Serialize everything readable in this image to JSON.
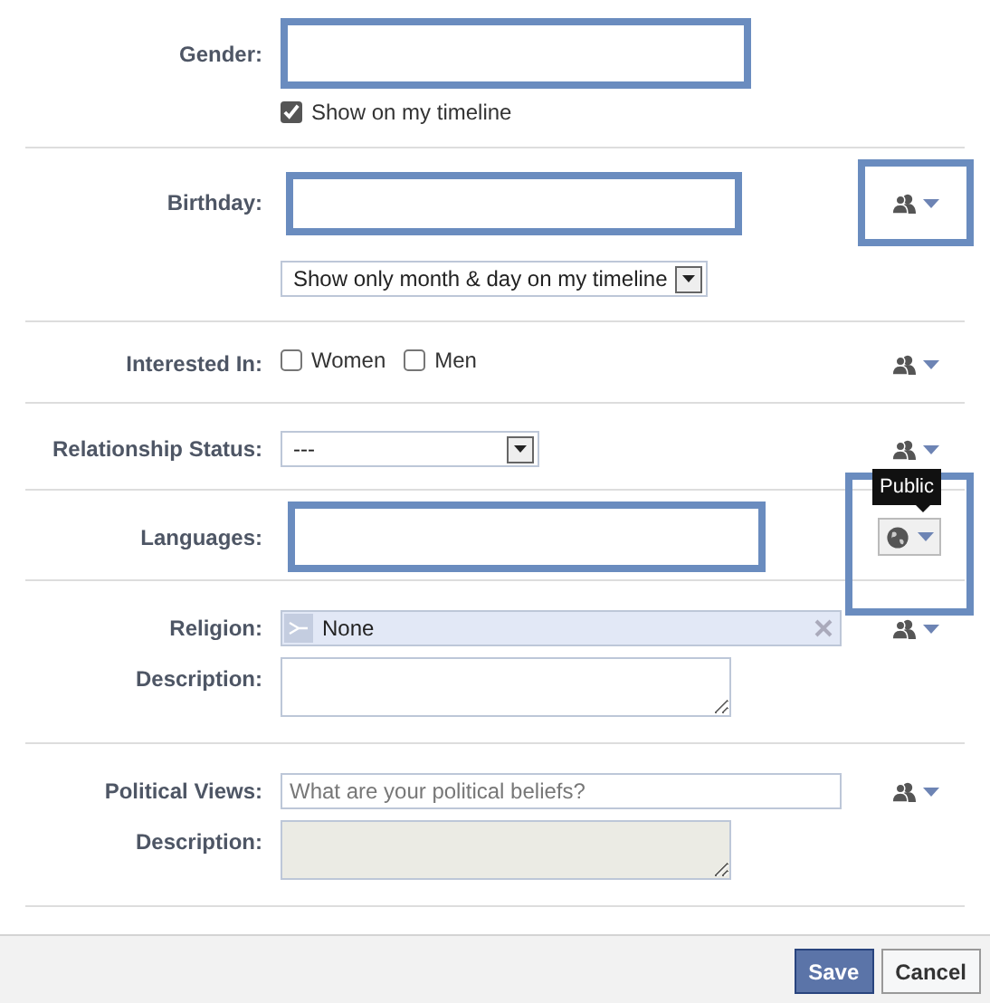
{
  "sections": [
    {
      "rows": [
        {
          "label": "Gender:",
          "control": {
            "kind": "text",
            "highlighted": true
          }
        },
        {
          "control": {
            "kind": "checkbox",
            "label": "Show on my timeline",
            "checked": true
          }
        }
      ]
    },
    {
      "rows": [
        {
          "label": "Birthday:",
          "control": {
            "kind": "text",
            "highlighted": true
          },
          "privacy": {
            "kind": "friends",
            "highlighted": true
          }
        },
        {
          "control": {
            "kind": "select",
            "value": "Show only month & day on my timeline"
          }
        }
      ]
    },
    {
      "rows": [
        {
          "label": "Interested In:",
          "control": {
            "kind": "checkboxes",
            "options": [
              {
                "label": "Women",
                "checked": false
              },
              {
                "label": "Men",
                "checked": false
              }
            ]
          },
          "privacy": {
            "kind": "friends",
            "highlighted": false
          }
        }
      ]
    },
    {
      "rows": [
        {
          "label": "Relationship Status:",
          "control": {
            "kind": "select",
            "value": "---"
          },
          "privacy": {
            "kind": "friends",
            "highlighted": false
          }
        }
      ]
    },
    {
      "rows": [
        {
          "label": "Languages:",
          "control": {
            "kind": "text",
            "highlighted": true
          },
          "privacy": {
            "kind": "public",
            "highlighted": true,
            "tooltip": "Public"
          }
        }
      ]
    },
    {
      "rows": [
        {
          "label": "Religion:",
          "control": {
            "kind": "token",
            "value": "None"
          },
          "privacy": {
            "kind": "friends",
            "highlighted": false
          }
        },
        {
          "label": "Description:",
          "control": {
            "kind": "textarea",
            "disabled": false
          }
        }
      ]
    },
    {
      "rows": [
        {
          "label": "Political Views:",
          "control": {
            "kind": "text",
            "highlighted": false,
            "placeholder": "What are your political beliefs?"
          },
          "privacy": {
            "kind": "friends",
            "highlighted": false
          }
        },
        {
          "label": "Description:",
          "control": {
            "kind": "textarea",
            "disabled": true
          }
        }
      ]
    }
  ],
  "buttons": [
    {
      "label": "Save",
      "kind": "primary"
    },
    {
      "label": "Cancel",
      "kind": "secondary"
    }
  ]
}
